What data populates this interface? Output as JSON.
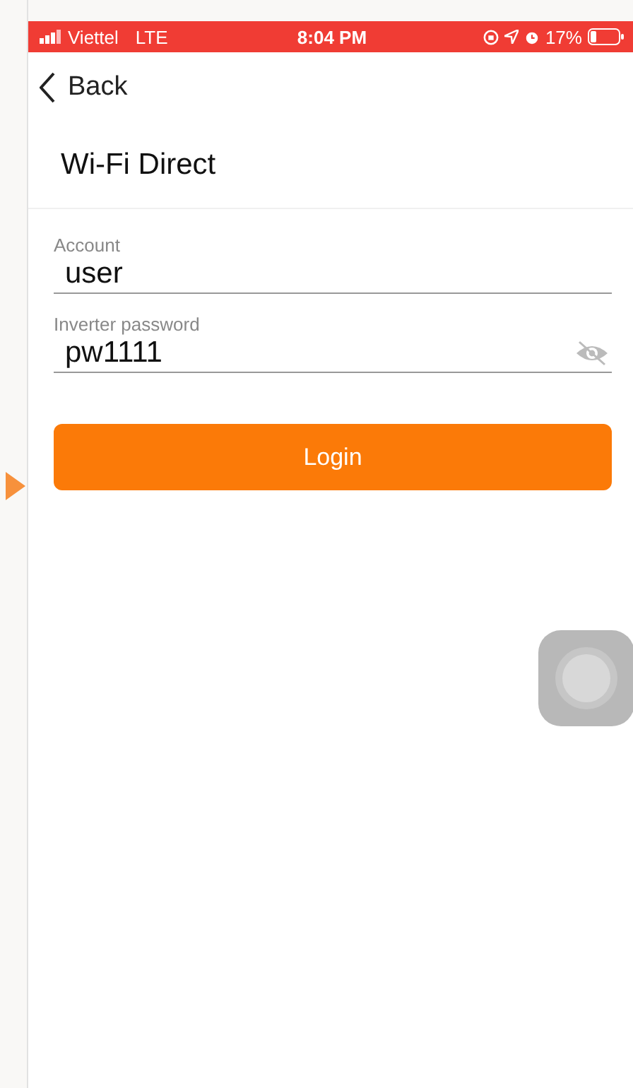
{
  "status_bar": {
    "carrier": "Viettel",
    "network": "LTE",
    "time": "8:04 PM",
    "battery": "17%"
  },
  "nav": {
    "back_label": "Back"
  },
  "title": "Wi-Fi Direct",
  "fields": [
    {
      "kind": "text",
      "label": "Account",
      "value": "user"
    },
    {
      "kind": "password",
      "label": "Inverter password",
      "value": "pw1111"
    }
  ],
  "login_button": "Login"
}
